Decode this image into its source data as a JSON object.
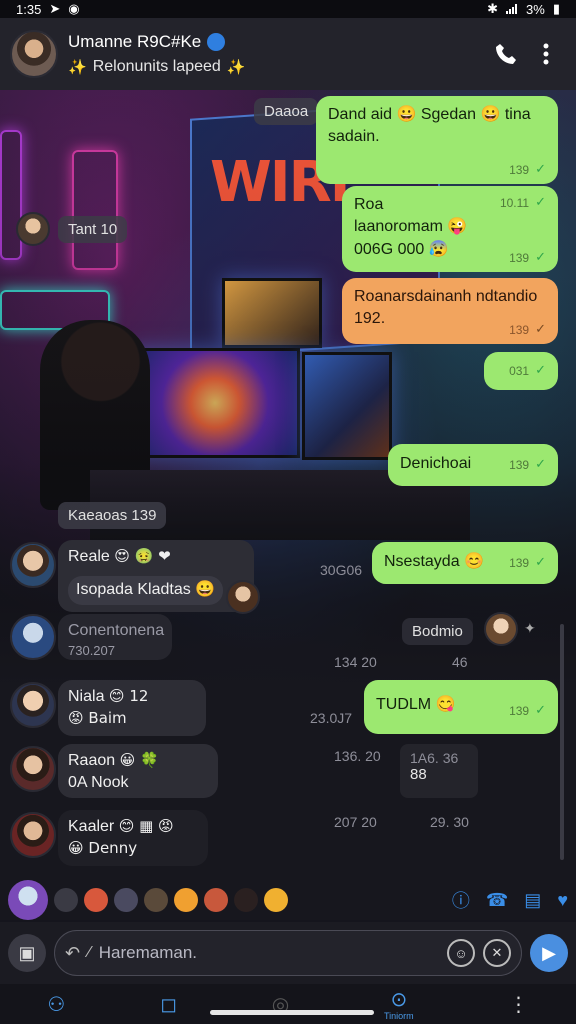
{
  "statusbar": {
    "time": "1:35",
    "battery": "3%"
  },
  "header": {
    "contact_name": "Umanne R9C#Ke",
    "status_text": "Relonunits lapeed",
    "status_emoji_left": "✨",
    "status_emoji_right": "✨"
  },
  "messages_out": [
    {
      "text": "Dand aid 😀 Sgedan 😀 tina sadain.",
      "time": "139"
    },
    {
      "lines": [
        "Roa",
        "laanoromam 😜",
        "006G 000 😰"
      ],
      "time": "139",
      "time2": "10.11"
    },
    {
      "text": "Roanarsdainanh ndtandio 192.",
      "time": "139",
      "color": "orange"
    },
    {
      "text": "",
      "time": "031"
    },
    {
      "text": "Denichoai",
      "time": "139"
    },
    {
      "text": "Nsestayda 😊",
      "time": "139"
    },
    {
      "text": "TUDLM 😋",
      "time": "139"
    }
  ],
  "chips": {
    "top_chip": "Daaoa",
    "chip_1": "Tant 10",
    "chip_2": "Kaeaoas 139",
    "chip_3": "Bodmio"
  },
  "messages_in": [
    {
      "sender": "Reale",
      "text": "Isopada Kladtas 😀",
      "emojis": "😍 🤢 ❤"
    },
    {
      "sender": "",
      "text": "Conentonena",
      "sub": "730.207"
    },
    {
      "sender": "Niala",
      "text": "😡 Baim",
      "emojis": "😊 12"
    },
    {
      "sender": "Raaon",
      "text": "0A Nook",
      "emojis": "😀 🍀"
    },
    {
      "sender": "Kaaler",
      "text": "😀 Denny",
      "emojis": "😊 ▦ 😡"
    }
  ],
  "timestamps": {
    "t1": "30G06",
    "t2": "134 20",
    "t2b": "46",
    "t3": "23.0J7",
    "t4": "136. 20",
    "t4b": "1A6. 36",
    "t4c": "88",
    "t5": "207 20",
    "t5b": "29. 30"
  },
  "composer": {
    "placeholder": "Haremaman."
  },
  "nav": {
    "item4_label": "Tiniorm"
  },
  "colors": {
    "outgoing": "#9ce870",
    "outgoing_alt": "#f2a45e",
    "accent": "#4a8fe0",
    "background": "#17171e"
  }
}
